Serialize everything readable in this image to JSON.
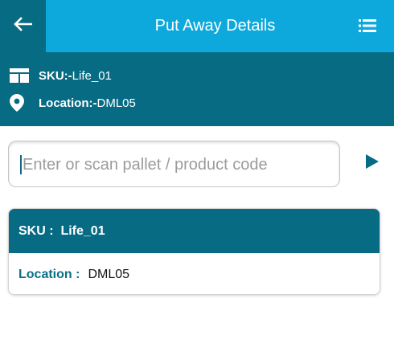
{
  "header": {
    "title": "Put Away Details",
    "back_icon": "arrow-left-icon",
    "menu_icon": "list-menu-icon",
    "colors": {
      "bar": "#0ea9dc",
      "back_bg": "#076b83"
    }
  },
  "info": {
    "sku_label": "SKU:-",
    "sku_value": " Life_01",
    "location_label": "Location:-",
    "location_value": "DML05",
    "sku_icon": "table-icon",
    "location_icon": "map-pin-icon"
  },
  "scan": {
    "placeholder": "Enter or scan pallet / product code",
    "value": "",
    "submit_icon": "play-icon"
  },
  "card": {
    "sku_label": "SKU :",
    "sku_value": "Life_01",
    "location_label": "Location :",
    "location_value": "DML05"
  }
}
